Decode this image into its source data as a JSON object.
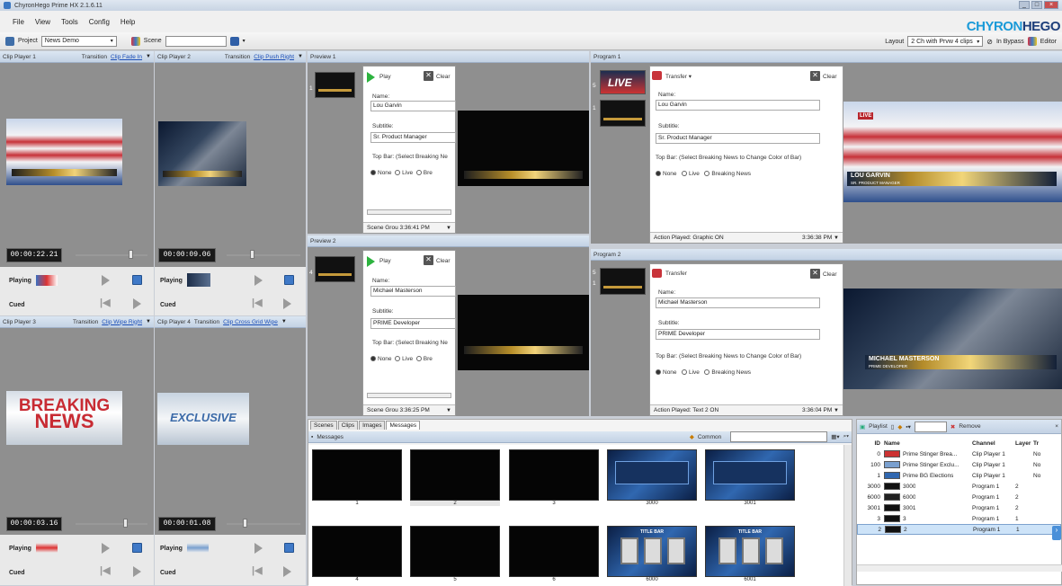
{
  "window": {
    "title": "ChyronHego Prime HX 2.1.6.11"
  },
  "menu": [
    "File",
    "View",
    "Tools",
    "Config",
    "Help"
  ],
  "brand": {
    "a": "CHYRON",
    "b": "HEGO"
  },
  "toolbar": {
    "project_label": "Project",
    "project_value": "News Demo",
    "scene_label": "Scene",
    "layout_label": "Layout",
    "layout_value": "2 Ch with Prvw 4 clips",
    "bypass_label": "In Bypass",
    "editor_label": "Editor"
  },
  "clip_players": [
    {
      "title": "Clip Player 1",
      "transition_label": "Transition",
      "transition": "Clip Fade In",
      "timer": "00:00:22.21",
      "status": "Playing",
      "cued": "Cued"
    },
    {
      "title": "Clip Player 2",
      "transition_label": "Transition",
      "transition": "Clip Push Right",
      "timer": "00:00:09.06",
      "status": "Playing",
      "cued": "Cued"
    },
    {
      "title": "Clip Player 3",
      "transition_label": "Transition",
      "transition": "Clip Wipe Right",
      "timer": "00:00:03.16",
      "status": "Playing",
      "cued": "Cued"
    },
    {
      "title": "Clip Player 4",
      "transition_label": "Transition",
      "transition": "Clip Cross Grid Wipe",
      "timer": "00:00:01.08",
      "status": "Playing",
      "cued": "Cued"
    }
  ],
  "breaking": {
    "line1": "BREAKING",
    "line2": "NEWS"
  },
  "exclusive": {
    "text": "EXCLUSIVE"
  },
  "previews": [
    {
      "title": "Preview 1",
      "num": "1",
      "play": "Play",
      "clear": "Clear",
      "name_label": "Name:",
      "name": "Lou Garvin",
      "subtitle_label": "Subtitle:",
      "subtitle": "Sr. Product Manager",
      "topbar_label": "Top Bar: (Select Breaking Ne",
      "r_none": "None",
      "r_live": "Live",
      "r_bre": "Bre",
      "scene": "Scene Grou 3:36:41 PM"
    },
    {
      "title": "Preview 2",
      "num": "4",
      "play": "Play",
      "clear": "Clear",
      "name_label": "Name:",
      "name": "Michael Masterson",
      "subtitle_label": "Subtitle:",
      "subtitle": "PRIME Developer",
      "topbar_label": "Top Bar: (Select Breaking Ne",
      "r_none": "None",
      "r_live": "Live",
      "r_bre": "Bre",
      "scene": "Scene Grou 3:36:25 PM"
    }
  ],
  "programs": [
    {
      "title": "Program 1",
      "num": "5",
      "num2": "1",
      "transfer": "Transfer",
      "clear": "Clear",
      "name_label": "Name:",
      "name": "Lou Garvin",
      "subtitle_label": "Subtitle:",
      "subtitle": "Sr. Product Manager",
      "topbar_label": "Top Bar: (Select Breaking News to Change Color of Bar)",
      "r_none": "None",
      "r_live": "Live",
      "r_bre": "Breaking News",
      "action": "Action Played: Graphic ON",
      "time": "3:36:38 PM",
      "live_badge": "LIVE",
      "lower_third": "LOU GARVIN",
      "lower_sub": "SR. PRODUCT MANAGER"
    },
    {
      "title": "Program 2",
      "num": "5",
      "num2": "1",
      "transfer": "Transfer",
      "clear": "Clear",
      "name_label": "Name:",
      "name": "Michael Masterson",
      "subtitle_label": "Subtitle:",
      "subtitle": "PRIME Developer",
      "topbar_label": "Top Bar: (Select Breaking News to Change Color of Bar)",
      "r_none": "None",
      "r_live": "Live",
      "r_bre": "Breaking News",
      "action": "Action Played: Text 2 ON",
      "time": "3:36:04 PM",
      "lower_third": "MICHAEL MASTERSON",
      "lower_sub": "PRIME DEVELOPER"
    }
  ],
  "library": {
    "tabs": [
      "Scenes",
      "Clips",
      "Images",
      "Messages"
    ],
    "active": "Messages",
    "header": "Messages",
    "common": "Common",
    "items": [
      "1",
      "2",
      "3",
      "3000",
      "3001",
      "4",
      "5",
      "6",
      "6000",
      "6001"
    ],
    "titlebar_text": "TITLE BAR"
  },
  "playlist": {
    "title": "Playlist",
    "remove": "Remove",
    "cols": [
      "ID",
      "Name",
      "Channel",
      "Layer",
      "Tr"
    ],
    "rows": [
      {
        "id": "0",
        "name": "Prime Stinger Brea...",
        "channel": "Clip Player 1",
        "layer": "",
        "tr": "No"
      },
      {
        "id": "100",
        "name": "Prime Stinger Exclu...",
        "channel": "Clip Player 1",
        "layer": "",
        "tr": "No"
      },
      {
        "id": "1",
        "name": "Prime BG Elections",
        "channel": "Clip Player 1",
        "layer": "",
        "tr": "No"
      },
      {
        "id": "3000",
        "name": "3000",
        "channel": "Program 1",
        "layer": "2",
        "tr": ""
      },
      {
        "id": "6000",
        "name": "6000",
        "channel": "Program 1",
        "layer": "2",
        "tr": ""
      },
      {
        "id": "3001",
        "name": "3001",
        "channel": "Program 1",
        "layer": "2",
        "tr": ""
      },
      {
        "id": "3",
        "name": "3",
        "channel": "Program 1",
        "layer": "1",
        "tr": ""
      },
      {
        "id": "2",
        "name": "2",
        "channel": "Program 1",
        "layer": "1",
        "tr": ""
      }
    ]
  },
  "colors": {
    "accent": "#1c4fb8",
    "brand_blue": "#1a9ad8",
    "panel_header": "#c3d2e4",
    "red": "#c8333a",
    "green": "#2db33f"
  }
}
